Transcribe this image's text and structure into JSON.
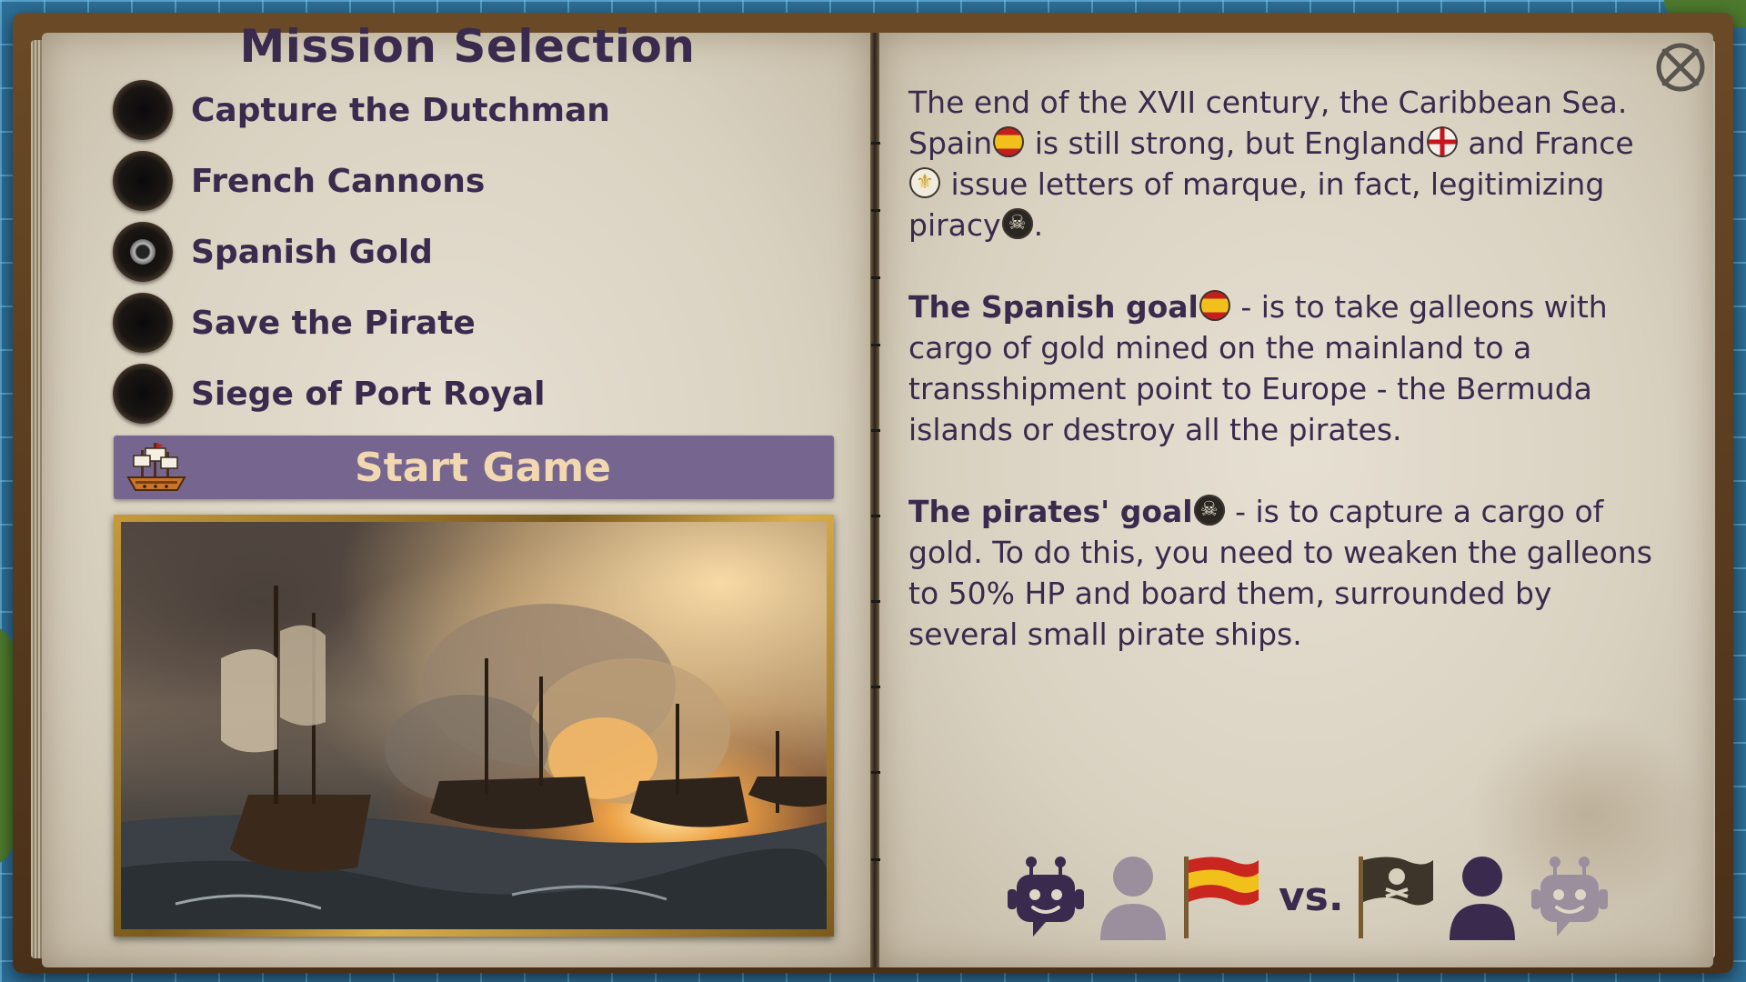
{
  "left_page": {
    "title": "Mission Selection",
    "missions": [
      {
        "label": "Capture the Dutchman",
        "selected": false
      },
      {
        "label": "French Cannons",
        "selected": false
      },
      {
        "label": "Spanish Gold",
        "selected": true
      },
      {
        "label": "Save the Pirate",
        "selected": false
      },
      {
        "label": "Siege of Port Royal",
        "selected": false
      }
    ],
    "start_button": {
      "label": "Start Game",
      "icon": "ship-icon"
    },
    "painting": {
      "icon": "naval-battle-painting"
    }
  },
  "right_page": {
    "close_icon": "close-icon",
    "paragraph_1": {
      "t1": "The end of the XVII century, the Caribbean Sea. Spain",
      "t2": " is still strong, but England",
      "t3": " and France",
      "t4": " issue letters of marque, in fact, legitimizing piracy",
      "t5": "."
    },
    "paragraph_2": {
      "bold": "The Spanish goal",
      "text": " - is to take galleons with cargo of gold mined on the mainland to a transshipment point to Europe - the Bermuda islands or destroy all the pirates."
    },
    "paragraph_3": {
      "bold": "The pirates' goal",
      "text": " - is to capture a cargo of gold. To do this, you need to weaken the galleons to 50% HP and board them, surrounded by several small pirate ships."
    },
    "versus": {
      "text": "vs.",
      "left": [
        "ai-player-icon",
        "human-player-icon",
        "spanish-flag-icon"
      ],
      "right": [
        "pirate-flag-icon",
        "human-player-icon",
        "ai-player-icon"
      ],
      "active_color": "#3a2a4d",
      "inactive_color": "#9b8f9d"
    }
  },
  "colors": {
    "ink": "#3a2a4d",
    "button_bg": "#76668f",
    "button_text": "#f2d8b0",
    "page": "#ded6c6",
    "map_water": "#2d6f98"
  }
}
